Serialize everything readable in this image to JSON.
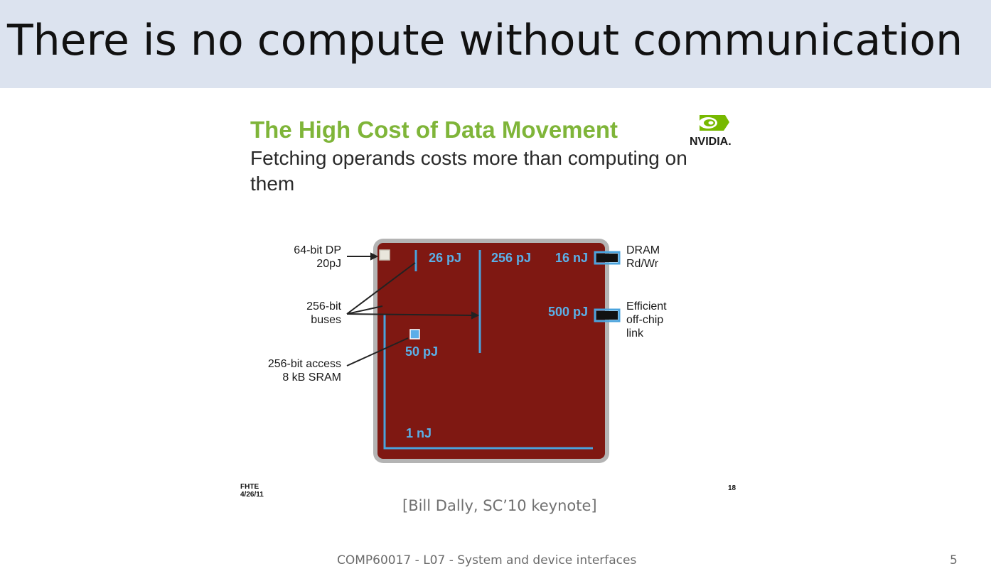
{
  "slide": {
    "title": "There is no compute without communication",
    "citation": "[Bill Dally, SC’10 keynote]",
    "course": "COMP60017 - L07 - System and device interfaces",
    "page_number": "5"
  },
  "embedded_slide": {
    "title": "The High Cost of Data Movement",
    "subtitle": "Fetching operands costs more than computing on them",
    "logo_text": "NVIDIA.",
    "footer_left_line1": "FHTE",
    "footer_left_line2": "4/26/11",
    "footer_right": "18"
  },
  "diagram": {
    "left_labels": {
      "dp_line1": "64-bit DP",
      "dp_line2": "20pJ",
      "buses_line1": "256-bit",
      "buses_line2": "buses",
      "sram_line1": "256-bit access",
      "sram_line2": "8 kB SRAM"
    },
    "right_labels": {
      "dram_line1": "DRAM",
      "dram_line2": "Rd/Wr",
      "link_line1": "Efficient",
      "link_line2": "off-chip",
      "link_line3": "link"
    },
    "energy_values": {
      "e26": "26 pJ",
      "e256": "256 pJ",
      "e16": "16 nJ",
      "e500": "500 pJ",
      "e50": "50 pJ",
      "e1": "1 nJ"
    },
    "colors": {
      "chip": "#7f1812",
      "chip_border": "#b4b4b4",
      "wire": "#4aa3dd",
      "label": "#5ab0e8",
      "pad": "#111111"
    }
  }
}
